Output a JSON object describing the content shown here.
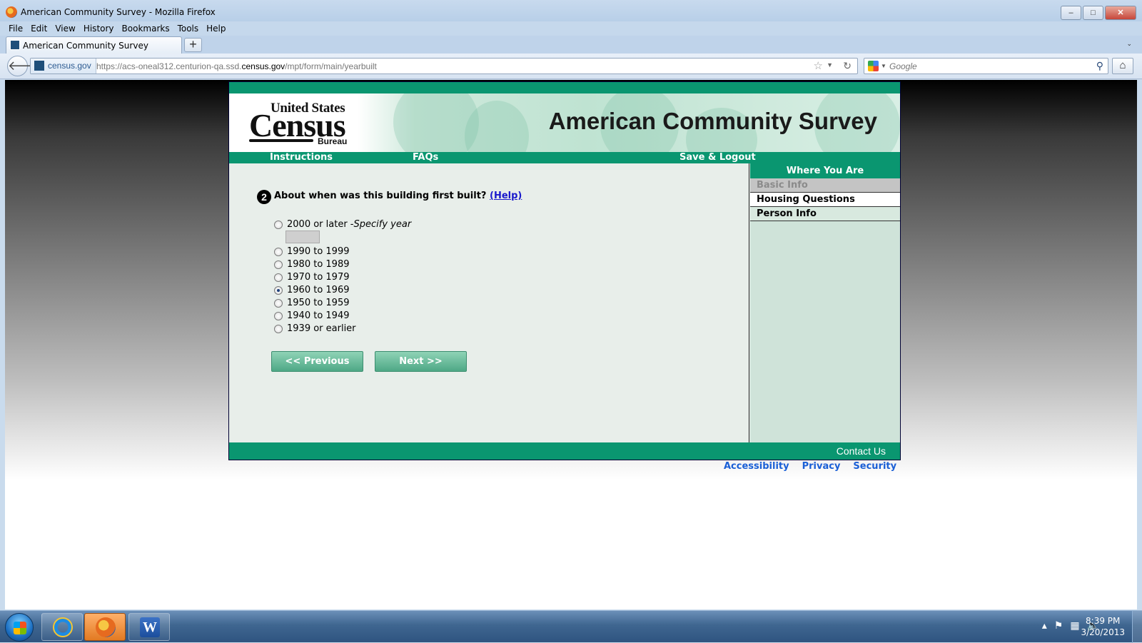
{
  "window": {
    "title": "American Community Survey - Mozilla Firefox",
    "minimize": "–",
    "maximize": "□",
    "close": "✕"
  },
  "menu": [
    "File",
    "Edit",
    "View",
    "History",
    "Bookmarks",
    "Tools",
    "Help"
  ],
  "tab": {
    "label": "American Community Survey",
    "new_tab": "+",
    "list_arrow": "⌄"
  },
  "navbar": {
    "site_identity": "census.gov",
    "url_prefix": "https://acs-oneal312.centurion-qa.ssd.",
    "url_domain": "census.gov",
    "url_path": "/mpt/form/main/yearbuilt",
    "search_placeholder": "Google"
  },
  "header": {
    "logo_line1": "United States",
    "logo_line2": "Census",
    "logo_line3": "Bureau",
    "title": "American Community Survey"
  },
  "nav": {
    "instructions": "Instructions",
    "faqs": "FAQs",
    "save_logout": "Save & Logout"
  },
  "question": {
    "number": "2",
    "text": "About when was this building first built?",
    "help": "(Help)",
    "options": [
      {
        "label": "2000 or later - ",
        "note": "Specify year",
        "selected": false
      },
      {
        "label": "1990 to 1999",
        "selected": false
      },
      {
        "label": "1980 to 1989",
        "selected": false
      },
      {
        "label": "1970 to 1979",
        "selected": false
      },
      {
        "label": "1960 to 1969",
        "selected": true
      },
      {
        "label": "1950 to 1959",
        "selected": false
      },
      {
        "label": "1940 to 1949",
        "selected": false
      },
      {
        "label": "1939 or earlier",
        "selected": false
      }
    ],
    "year_value": ""
  },
  "buttons": {
    "previous": "<<   Previous",
    "next": "Next   >>"
  },
  "sidebar": {
    "heading": "Where You Are",
    "items": [
      "Basic Info",
      "Housing Questions",
      "Person Info"
    ]
  },
  "footer": {
    "contact": "Contact Us"
  },
  "links": [
    "Accessibility",
    "Privacy",
    "Security"
  ],
  "taskbar": {
    "time": "8:39 PM",
    "date": "3/20/2013",
    "word_icon": "W"
  },
  "colors": {
    "census_green": "#0a9670",
    "link_blue": "#1a5fd6",
    "sidebar_bg": "#cfe3d9"
  }
}
